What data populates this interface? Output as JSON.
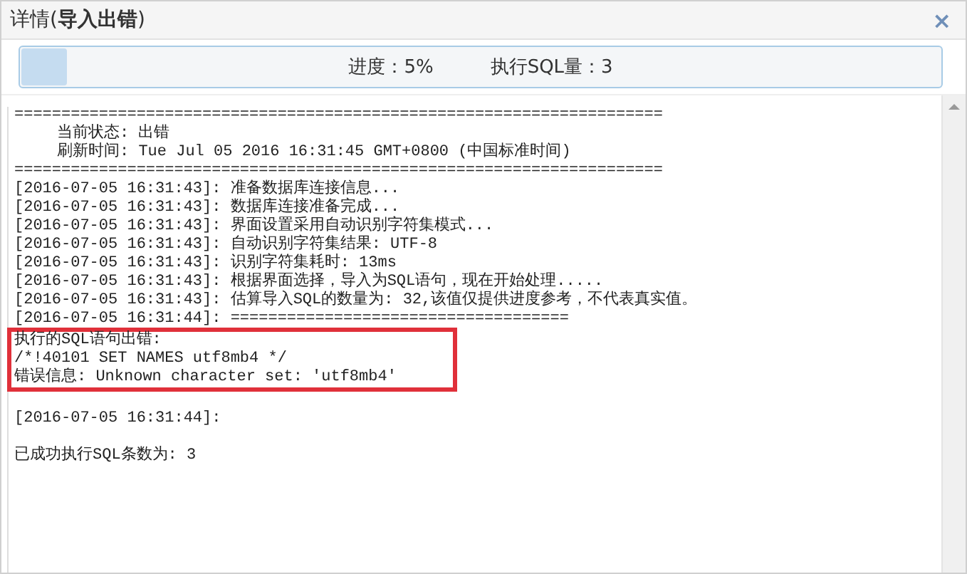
{
  "dialog": {
    "title": "详情(**导入出错**)",
    "close": "×"
  },
  "progress": {
    "level": 0.05,
    "percent_text": "进度：5%",
    "count_text": "执行SQL量：3"
  },
  "log": {
    "blocks": [
      {
        "highlighted": false,
        "lines": [
          {
            "text": "=====================================================================",
            "indent": false
          },
          {
            "text": "当前状态: 出错",
            "indent": true
          },
          {
            "text": "刷新时间: Tue Jul 05 2016 16:31:45 GMT+0800 (中国标准时间)",
            "indent": true
          },
          {
            "text": "=====================================================================",
            "indent": false
          },
          {
            "text": "[2016-07-05 16:31:43]: 准备数据库连接信息...",
            "indent": false
          },
          {
            "text": "[2016-07-05 16:31:43]: 数据库连接准备完成...",
            "indent": false
          },
          {
            "text": "[2016-07-05 16:31:43]: 界面设置采用自动识别字符集模式...",
            "indent": false
          },
          {
            "text": "[2016-07-05 16:31:43]: 自动识别字符集结果: UTF-8",
            "indent": false
          },
          {
            "text": "[2016-07-05 16:31:43]: 识别字符集耗时: 13ms",
            "indent": false
          },
          {
            "text": "[2016-07-05 16:31:43]: 根据界面选择，导入为SQL语句，现在开始处理.....",
            "indent": false
          },
          {
            "text": "[2016-07-05 16:31:43]: 估算导入SQL的数量为: 32,该值仅提供进度参考，不代表真实值。",
            "indent": false
          },
          {
            "text": "[2016-07-05 16:31:44]: ====================================",
            "indent": false
          }
        ]
      },
      {
        "highlighted": true,
        "lines": [
          {
            "text": "执行的SQL语句出错:",
            "indent": false
          },
          {
            "text": "/*!40101 SET NAMES utf8mb4 */",
            "indent": false
          },
          {
            "text": "错误信息: Unknown character set: 'utf8mb4'",
            "indent": false
          }
        ]
      },
      {
        "highlighted": false,
        "lines": [
          {
            "text": "[2016-07-05 16:31:44]:",
            "indent": false
          }
        ]
      },
      {
        "highlighted": false,
        "lines": [
          {
            "text": "已成功执行SQL条数为: 3",
            "indent": false
          }
        ]
      }
    ]
  }
}
